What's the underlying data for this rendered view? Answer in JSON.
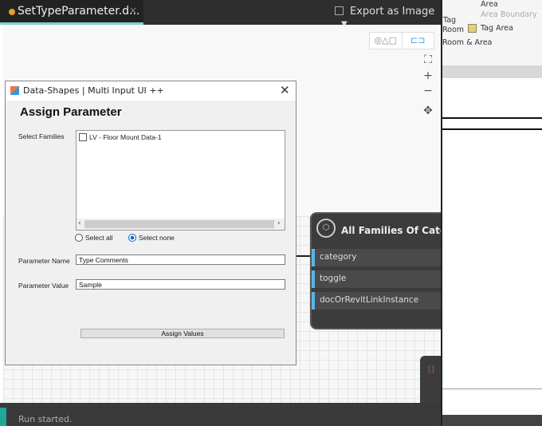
{
  "dynamo": {
    "tab_title": "SetTypeParameter.d...",
    "tab_close": "×",
    "export_label": "Export as Image",
    "export_caret": "▼",
    "view_buttons": [
      "◎△▢",
      "⊏⊐"
    ],
    "zoom_fit": "⛶",
    "zoom_in": "+",
    "zoom_out": "−",
    "pan": "✥",
    "status": "Run started.",
    "node": {
      "title": "All Families Of Category",
      "ports": [
        "category",
        "toggle",
        "docOrRevitLinkInstance"
      ]
    },
    "node2_label": "[]"
  },
  "revit": {
    "items": [
      "Area",
      "Area Boundary",
      "Tag",
      "Room",
      "Tag Area",
      "Room & Area"
    ]
  },
  "dialog": {
    "title": "Data-Shapes | Multi Input UI ++",
    "close": "✕",
    "heading": "Assign Parameter",
    "select_families_label": "Select Families",
    "families": [
      "LV - Floor Mount Data-1"
    ],
    "select_all": "Select all",
    "select_none": "Select none",
    "selected_radio": "Select none",
    "param_name_label": "Parameter Name",
    "param_name_value": "Type Comments",
    "param_value_label": "Parameter Value",
    "param_value_value": "Sample",
    "assign_button": "Assign Values"
  }
}
